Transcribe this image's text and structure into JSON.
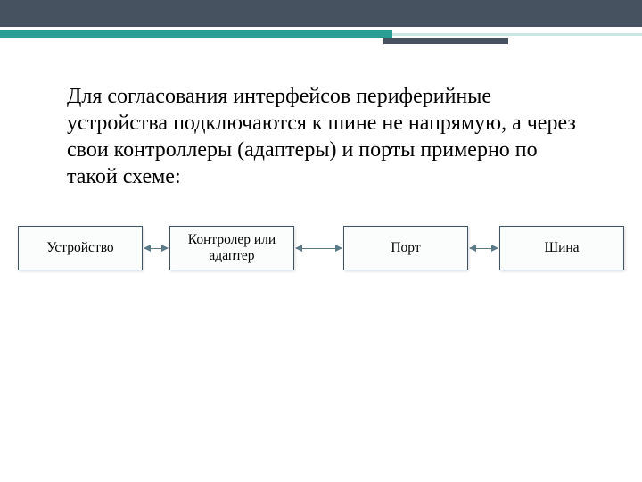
{
  "text": {
    "paragraph": "Для согласования интерфейсов периферийные устройства подключаются к шине не напрямую, а через свои контроллеры (адаптеры) и порты примерно по такой схеме:"
  },
  "diagram": {
    "nodes": [
      {
        "label": "Устройство"
      },
      {
        "label": "Контролер или адаптер"
      },
      {
        "label": "Порт"
      },
      {
        "label": "Шина"
      }
    ],
    "connections": [
      {
        "from": 0,
        "to": 1,
        "bidirectional": true
      },
      {
        "from": 1,
        "to": 2,
        "bidirectional": true
      },
      {
        "from": 2,
        "to": 3,
        "bidirectional": true
      }
    ]
  },
  "palette": {
    "header_bg": "#475261",
    "accent_teal": "#2a9d94",
    "node_border": "#415464",
    "arrow_color": "#5b7b88"
  }
}
